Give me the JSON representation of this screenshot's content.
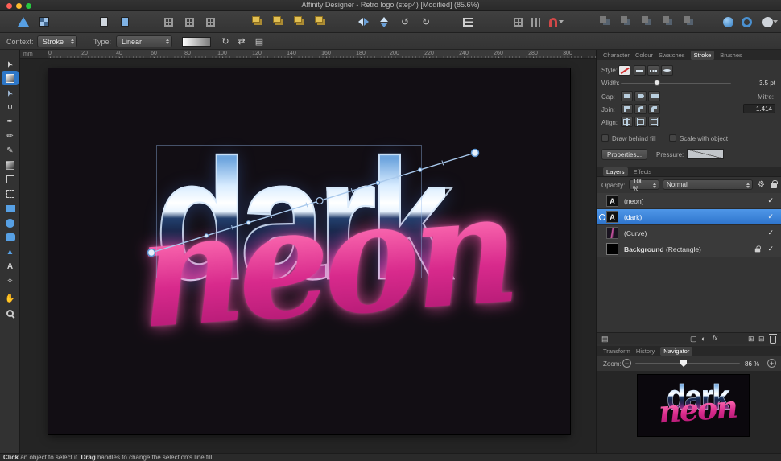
{
  "titlebar": {
    "title": "Affinity Designer - Retro logo (step4) [Modified] (85.6%)"
  },
  "context_bar": {
    "context_label": "Context:",
    "context_value": "Stroke",
    "type_label": "Type:",
    "type_value": "Linear"
  },
  "ruler": {
    "unit": "mm",
    "ticks": [
      "0",
      "20",
      "40",
      "60",
      "80",
      "100",
      "120",
      "140",
      "160",
      "180",
      "200",
      "220",
      "240",
      "260",
      "280",
      "300"
    ]
  },
  "tools": [
    {
      "name": "move-tool",
      "glyph": "➤"
    },
    {
      "name": "fill-tool",
      "glyph": ""
    },
    {
      "name": "node-tool",
      "glyph": "➤"
    },
    {
      "name": "corner-tool",
      "glyph": "∪"
    },
    {
      "name": "pen-tool",
      "glyph": "✒"
    },
    {
      "name": "pencil-tool",
      "glyph": "✏"
    },
    {
      "name": "brush-tool",
      "glyph": "✎"
    },
    {
      "name": "transparency-tool",
      "glyph": ""
    },
    {
      "name": "crop-tool",
      "glyph": ""
    },
    {
      "name": "vector-crop-tool",
      "glyph": ""
    },
    {
      "name": "rectangle-tool",
      "glyph": ""
    },
    {
      "name": "ellipse-tool",
      "glyph": ""
    },
    {
      "name": "rounded-rectangle-tool",
      "glyph": ""
    },
    {
      "name": "triangle-tool",
      "glyph": "▲"
    },
    {
      "name": "text-tool",
      "glyph": "A"
    },
    {
      "name": "colour-picker-tool",
      "glyph": "✧"
    },
    {
      "name": "view-tool",
      "glyph": "✋"
    },
    {
      "name": "zoom-tool",
      "glyph": ""
    }
  ],
  "stroke_panel": {
    "tabs": [
      "Character",
      "Colour",
      "Swatches",
      "Stroke",
      "Brushes"
    ],
    "style_label": "Style:",
    "width_label": "Width:",
    "width_value": "3.5 pt",
    "cap_label": "Cap:",
    "mitre_label": "Mitre:",
    "join_label": "Join:",
    "mitre_value": "1.414",
    "align_label": "Align:",
    "draw_behind_fill_label": "Draw behind fill",
    "scale_with_object_label": "Scale with object",
    "properties_button": "Properties...",
    "pressure_label": "Pressure:"
  },
  "layers_panel": {
    "tabs": [
      "Layers",
      "Effects"
    ],
    "opacity_label": "Opacity:",
    "opacity_value": "100 %",
    "blend_mode": "Normal",
    "layers": [
      {
        "name": "(neon)"
      },
      {
        "name": "(dark)"
      },
      {
        "name": "(Curve)"
      },
      {
        "name": "Background",
        "suffix": " (Rectangle)"
      }
    ]
  },
  "navigator_panel": {
    "tabs": [
      "Transform",
      "History",
      "Navigator"
    ],
    "zoom_label": "Zoom:",
    "zoom_value": "86 %"
  },
  "artwork": {
    "word1": "dark",
    "word2": "neon"
  },
  "status_bar": {
    "action1": "Click",
    "text1": " an object to select it. ",
    "action2": "Drag",
    "text2": " handles to change the selection's line fill."
  },
  "glyphs": {
    "check": "✓",
    "gear": "⚙",
    "fx": "fx",
    "rotate_cw": "↻",
    "rotate_ccw": "↺",
    "reverse": "⇄",
    "profile": "▤",
    "stack": "▤",
    "mask": "▢",
    "adjustment": "◐",
    "add_layer": "⊞",
    "add_group": "⊟",
    "minus": "−",
    "plus": "+"
  }
}
